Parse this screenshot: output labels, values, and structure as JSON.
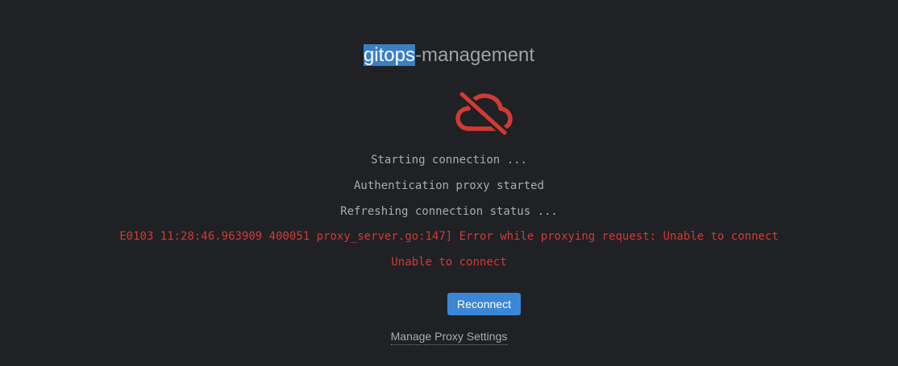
{
  "title": {
    "selected_part": "gitops",
    "rest": "-management"
  },
  "status_icon": "cloud-offline-icon",
  "colors": {
    "background": "#1f2124",
    "error": "#d23a34",
    "accent": "#3b87d6",
    "text": "#a8abb0"
  },
  "messages": [
    "Starting connection ...",
    "Authentication proxy started",
    "Refreshing connection status ..."
  ],
  "errors": [
    "E0103 11:28:46.963909 400051 proxy_server.go:147] Error while proxying request: Unable to connect",
    "Unable to connect"
  ],
  "actions": {
    "reconnect_label": "Reconnect",
    "manage_proxy_label": "Manage Proxy Settings"
  }
}
